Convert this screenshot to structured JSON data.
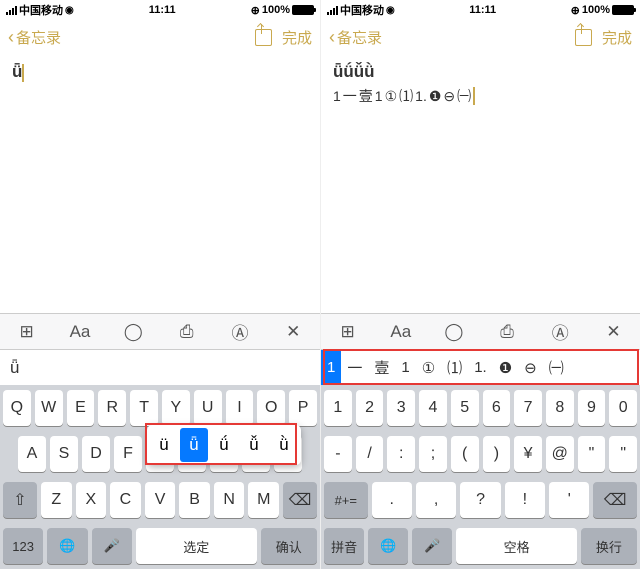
{
  "status": {
    "carrier": "中国移动",
    "time": "11:11",
    "battery": "100%",
    "bicon": "⊕"
  },
  "nav": {
    "back": "备忘录",
    "done": "完成"
  },
  "left": {
    "note_text": "ǖ",
    "cand": [
      "ǖ"
    ],
    "rows": [
      [
        "Q",
        "W",
        "E",
        "R",
        "T",
        "Y",
        "U",
        "I",
        "O",
        "P"
      ],
      [
        "A",
        "S",
        "D",
        "F",
        "G",
        "H",
        "J",
        "K",
        "L"
      ],
      [
        "Z",
        "X",
        "C",
        "V",
        "B",
        "N",
        "M"
      ]
    ],
    "popup": [
      "ü",
      "ǖ",
      "ǘ",
      "ǚ",
      "ǜ"
    ],
    "popup_sel": 1,
    "bottom": {
      "k123": "123",
      "select": "选定",
      "confirm": "确认"
    }
  },
  "right": {
    "note_text": "ǖǘǚǜ",
    "note_line2": [
      "1",
      "一",
      "壹",
      "1",
      "①",
      "⑴",
      "1.",
      "❶",
      "⊖",
      "㈠"
    ],
    "cand": [
      "1",
      "一",
      "壹",
      "1",
      "①",
      "⑴",
      "1.",
      "❶",
      "⊖",
      "㈠"
    ],
    "rows": [
      [
        "1",
        "2",
        "3",
        "4",
        "5",
        "6",
        "7",
        "8",
        "9",
        "0"
      ],
      [
        "-",
        "/",
        ":",
        ";",
        "(",
        ")",
        "¥",
        "@",
        "\"",
        "\""
      ],
      [
        ".",
        ",",
        "?",
        "!",
        "'"
      ]
    ],
    "bottom": {
      "pinyin": "拼音",
      "space": "空格",
      "newline": "换行",
      "alt": "#+="
    }
  },
  "icons": {
    "grid": "⊞",
    "aa": "Aa",
    "check": "✓",
    "cam": "📷",
    "pen": "✎",
    "x": "✕",
    "shift": "⇧",
    "del": "⌫",
    "globe": "🌐",
    "mic": "🎤"
  }
}
